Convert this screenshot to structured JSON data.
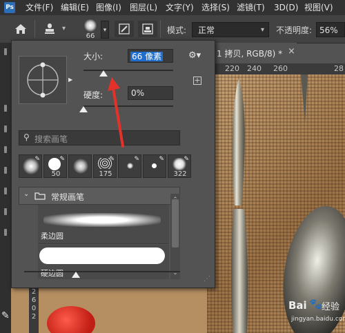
{
  "menubar": {
    "logo": "Ps",
    "items": [
      "文件(F)",
      "编辑(E)",
      "图像(I)",
      "图层(L)",
      "文字(Y)",
      "选择(S)",
      "滤镜(T)",
      "3D(D)",
      "视图(V)"
    ]
  },
  "options": {
    "brush_size": "66",
    "mode_label": "模式:",
    "mode_value": "正常",
    "opacity_label": "不透明度:",
    "opacity_value": "56%"
  },
  "document": {
    "tab_title": "1 拷贝, RGB/8) *",
    "ruler_ticks": [
      "220",
      "240",
      "260",
      "28"
    ]
  },
  "brush_panel": {
    "size_label": "大小:",
    "size_value": "66 像素",
    "hardness_label": "硬度:",
    "hardness_value": "0%",
    "size_fraction": 0.22,
    "hardness_fraction": 0.0,
    "search_placeholder": "搜索画笔",
    "presets": [
      {
        "label": "",
        "kind": "soft-large"
      },
      {
        "label": "50",
        "kind": "hard"
      },
      {
        "label": "",
        "kind": "soft"
      },
      {
        "label": "175",
        "kind": "spatter"
      },
      {
        "label": "",
        "kind": "small-soft"
      },
      {
        "label": "",
        "kind": "small-hard"
      },
      {
        "label": "322",
        "kind": "texture"
      }
    ],
    "group_name": "常规画笔",
    "brushes": [
      {
        "name": "柔边圆"
      },
      {
        "name": "硬边圆"
      }
    ]
  },
  "watermark": {
    "brand": "Bai",
    "brand2": "经验",
    "url": "jingyan.baidu.com"
  },
  "colors": {
    "accent_selection": "#1f6fd1",
    "annotation_arrow": "#e4322b",
    "panel_bg": "#535353"
  }
}
